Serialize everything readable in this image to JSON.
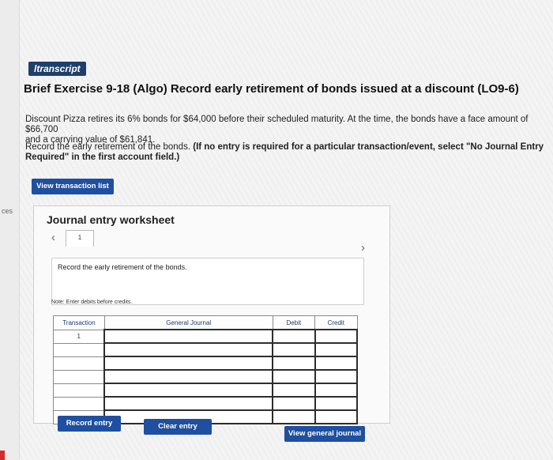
{
  "left_strip": {
    "label": "ces"
  },
  "header": {
    "tag": "ltranscript",
    "title": "Brief Exercise 9-18 (Algo) Record early retirement of bonds issued at a discount (LO9-6)"
  },
  "problem": {
    "paragraph1_line1": "Discount Pizza retires its 6% bonds for $64,000 before their scheduled maturity. At the time, the bonds have a face amount of $66,700",
    "paragraph1_line2": "and a carrying value of $61,841.",
    "paragraph2_plain": "Record the early retirement of the bonds. ",
    "paragraph2_bold": "(If no entry is required for a particular transaction/event, select \"No Journal Entry Required\" in the first account field.)"
  },
  "buttons": {
    "view_transaction_list": "View transaction list",
    "record_entry": "Record entry",
    "clear_entry": "Clear entry",
    "view_general_journal": "View general journal"
  },
  "worksheet": {
    "title": "Journal entry worksheet",
    "current_page": "1",
    "prev_icon": "chevron-left-icon",
    "next_icon": "chevron-right-icon",
    "instruction": "Record the early retirement of the bonds.",
    "note": "Note: Enter debits before credits."
  },
  "journal_table": {
    "headers": {
      "transaction": "Transaction",
      "general_journal": "General Journal",
      "debit": "Debit",
      "credit": "Credit"
    },
    "rows": [
      {
        "transaction": "1",
        "account": "",
        "debit": "",
        "credit": ""
      },
      {
        "transaction": "",
        "account": "",
        "debit": "",
        "credit": ""
      },
      {
        "transaction": "",
        "account": "",
        "debit": "",
        "credit": ""
      },
      {
        "transaction": "",
        "account": "",
        "debit": "",
        "credit": ""
      },
      {
        "transaction": "",
        "account": "",
        "debit": "",
        "credit": ""
      },
      {
        "transaction": "",
        "account": "",
        "debit": "",
        "credit": ""
      },
      {
        "transaction": "",
        "account": "",
        "debit": "",
        "credit": ""
      }
    ]
  },
  "colors": {
    "primary_button": "#1f4fa0",
    "tag_background": "#1f3f6b",
    "table_header_text": "#1b3c6e"
  }
}
